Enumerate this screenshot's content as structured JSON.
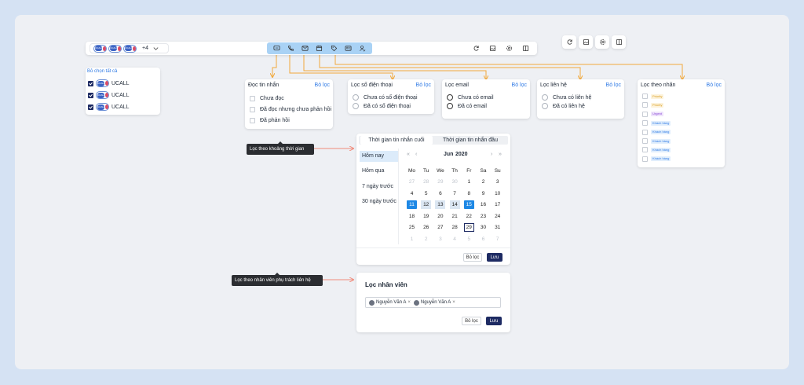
{
  "toolbar": {
    "more_count": "+4",
    "chip_logo": "UCALL"
  },
  "select_panel": {
    "select_all": "Bỏ chọn tất cả",
    "items": [
      "UCALL",
      "UCALL",
      "UCALL"
    ]
  },
  "read_filter": {
    "title": "Đọc tin nhắn",
    "clear": "Bỏ lọc",
    "options": [
      "Chưa đọc",
      "Đã đọc nhưng chưa phản hồi",
      "Đã phản hồi"
    ]
  },
  "phone_filter": {
    "title": "Lọc số điện thoại",
    "clear": "Bỏ lọc",
    "options": [
      "Chưa có số điện thoại",
      "Đã có số điện thoại"
    ]
  },
  "email_filter": {
    "title": "Lọc email",
    "clear": "Bỏ lọc",
    "options": [
      "Chưa có email",
      "Đã có email"
    ]
  },
  "contact_filter": {
    "title": "Lọc liên hệ",
    "clear": "Bỏ lọc",
    "options": [
      "Chưa có liên hệ",
      "Đã có liên hệ"
    ]
  },
  "label_filter": {
    "title": "Lọc theo nhãn",
    "clear": "Bỏ lọc",
    "tags": [
      {
        "text": "Priority",
        "color": "#d89b1c",
        "bg": "#fdf3dc"
      },
      {
        "text": "Priority",
        "color": "#d89b1c",
        "bg": "#fdf3dc"
      },
      {
        "text": "Urgent",
        "color": "#8a4bd6",
        "bg": "#efe4fb"
      },
      {
        "text": "Khách hàng",
        "color": "#2f7ae5",
        "bg": "#e1eefc"
      },
      {
        "text": "Khách hàng",
        "color": "#2f7ae5",
        "bg": "#e1eefc"
      },
      {
        "text": "Khách hàng",
        "color": "#2f7ae5",
        "bg": "#e1eefc"
      },
      {
        "text": "Khách hàng",
        "color": "#2f7ae5",
        "bg": "#e1eefc"
      },
      {
        "text": "Khách hàng",
        "color": "#2f7ae5",
        "bg": "#e1eefc"
      }
    ]
  },
  "tooltips": {
    "time": "Lọc theo khoảng thời gian",
    "staff": "Lọc theo nhân viên phụ trách liên hệ"
  },
  "date_picker": {
    "tabs": [
      "Thời gian tin nhắn cuối",
      "Thời gian tin nhắn đầu"
    ],
    "presets": [
      "Hôm nay",
      "Hôm qua",
      "7 ngày trước",
      "30 ngày trước"
    ],
    "month": "Jun",
    "year": "2020",
    "weekdays": [
      "Mo",
      "Tu",
      "We",
      "Th",
      "Fr",
      "Sa",
      "Su"
    ],
    "weeks": [
      [
        "27",
        "28",
        "29",
        "30",
        "1",
        "2",
        "3"
      ],
      [
        "4",
        "5",
        "6",
        "7",
        "8",
        "9",
        "10"
      ],
      [
        "11",
        "12",
        "13",
        "14",
        "15",
        "16",
        "17"
      ],
      [
        "18",
        "19",
        "20",
        "21",
        "22",
        "23",
        "24"
      ],
      [
        "25",
        "26",
        "27",
        "28",
        "29",
        "30",
        "31"
      ],
      [
        "1",
        "2",
        "3",
        "4",
        "5",
        "6",
        "7"
      ]
    ],
    "range_start": "11",
    "range_end": "15",
    "today": "29",
    "clear": "Bỏ lọc",
    "save": "Lưu"
  },
  "staff_filter": {
    "title": "Lọc nhân viên",
    "people": [
      "Nguyễn Văn A",
      "Nguyễn Văn A"
    ],
    "clear": "Bỏ lọc",
    "save": "Lưu"
  },
  "colors": {
    "accent": "#1e2b63",
    "link": "#2f7ae5",
    "connector": "#f2a93b",
    "arrow": "#f08a7a",
    "selected_day": "#1e88e5"
  }
}
